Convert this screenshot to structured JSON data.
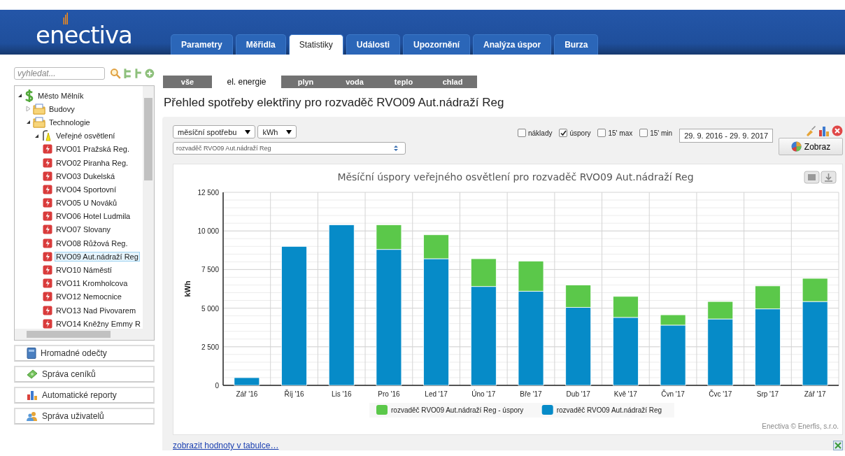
{
  "header": {
    "logo": "enectiva",
    "tabs": [
      {
        "label": "Parametry",
        "selected": false
      },
      {
        "label": "Měřidla",
        "selected": false
      },
      {
        "label": "Statistiky",
        "selected": true
      },
      {
        "label": "Události",
        "selected": false
      },
      {
        "label": "Upozornění",
        "selected": false
      },
      {
        "label": "Analýza úspor",
        "selected": false
      },
      {
        "label": "Burza",
        "selected": false
      }
    ]
  },
  "sidebar": {
    "search": {
      "placeholder": "vyhledat..."
    },
    "tree": [
      {
        "label": "Město Mělník",
        "kind": "root",
        "expanded": true,
        "selected": false,
        "children": [
          {
            "label": "Budovy",
            "kind": "folder",
            "expanded": false,
            "selected": false
          },
          {
            "label": "Technologie",
            "kind": "folder",
            "expanded": true,
            "selected": false,
            "children": [
              {
                "label": "Veřejné osvětlení",
                "kind": "lamp",
                "expanded": true,
                "selected": false,
                "children": [
                  {
                    "label": "RVO01 Pražská Reg.",
                    "kind": "meter",
                    "selected": false
                  },
                  {
                    "label": "RVO02 Piranha Reg.",
                    "kind": "meter",
                    "selected": false
                  },
                  {
                    "label": "RVO03 Dukelská",
                    "kind": "meter",
                    "selected": false
                  },
                  {
                    "label": "RVO04 Sportovní",
                    "kind": "meter",
                    "selected": false
                  },
                  {
                    "label": "RVO05 U Nováků",
                    "kind": "meter",
                    "selected": false
                  },
                  {
                    "label": "RVO06 Hotel Ludmila",
                    "kind": "meter",
                    "selected": false
                  },
                  {
                    "label": "RVO07 Slovany",
                    "kind": "meter",
                    "selected": false
                  },
                  {
                    "label": "RVO08 Růžová Reg.",
                    "kind": "meter",
                    "selected": false
                  },
                  {
                    "label": "RVO09 Aut.nádraží Reg",
                    "kind": "meter",
                    "selected": true
                  },
                  {
                    "label": "RVO10 Náměstí",
                    "kind": "meter",
                    "selected": false
                  },
                  {
                    "label": "RVO11 Kromholcova",
                    "kind": "meter",
                    "selected": false
                  },
                  {
                    "label": "RVO12 Nemocnice",
                    "kind": "meter",
                    "selected": false
                  },
                  {
                    "label": "RVO13 Nad Pivovarem",
                    "kind": "meter",
                    "selected": false
                  },
                  {
                    "label": "RVO14 Kněžny Emmy R",
                    "kind": "meter",
                    "selected": false
                  }
                ]
              }
            ]
          }
        ]
      }
    ],
    "buttons": [
      {
        "label": "Hromadné odečty",
        "kind": "book"
      },
      {
        "label": "Správa ceníků",
        "kind": "money"
      },
      {
        "label": "Automatické reporty",
        "kind": "bars"
      },
      {
        "label": "Správa uživatelů",
        "kind": "users"
      }
    ]
  },
  "energy_tabs": [
    {
      "label": "vše",
      "selected": false
    },
    {
      "label": "el. energie",
      "selected": true
    },
    {
      "label": "plyn",
      "selected": false
    },
    {
      "label": "voda",
      "selected": false
    },
    {
      "label": "teplo",
      "selected": false
    },
    {
      "label": "chlad",
      "selected": false
    }
  ],
  "heading": "Přehled spotřeby elektřiny pro rozvaděč RVO09 Aut.nádraží Reg",
  "controls": {
    "period": "měsíční spotřebu",
    "unit": "kWh",
    "meter": "rozvaděč RVO09 Aut.nádraží Reg",
    "options": [
      {
        "label": "náklady",
        "checked": false
      },
      {
        "label": "úspory",
        "checked": true
      },
      {
        "label": "15' max",
        "checked": false
      },
      {
        "label": "15' min",
        "checked": false
      }
    ],
    "date_range": "29. 9. 2016 - 29. 9. 2017",
    "show_button": "Zobraz"
  },
  "chart": {
    "credit": "Enectiva © Enerfis, s.r.o.",
    "chart_data": {
      "type": "bar",
      "title": "Měsíční úspory veřejného osvětlení pro rozvaděč RVO09 Aut.nádraží Reg",
      "ylabel": "kWh",
      "stacked": true,
      "categories": [
        "Zář '16",
        "Říj '16",
        "Lis '16",
        "Pro '16",
        "Led '17",
        "Úno '17",
        "Bře '17",
        "Dub '17",
        "Kvě '17",
        "Čvn '17",
        "Čvc '17",
        "Srp '17",
        "Zář '17"
      ],
      "series": [
        {
          "name": "rozvaděč RVO09 Aut.nádraží Reg - úspory",
          "color": "#5bc84a",
          "values": [
            0,
            0,
            0,
            1600,
            1550,
            1800,
            1950,
            1450,
            1360,
            670,
            1130,
            1490,
            1500
          ]
        },
        {
          "name": "rozvaděč RVO09 Aut.nádraží Reg",
          "color": "#068bc8",
          "values": [
            500,
            9000,
            10400,
            8800,
            8200,
            6400,
            6100,
            5050,
            4400,
            3900,
            4300,
            4950,
            5430
          ]
        }
      ],
      "ylim": [
        0,
        12500
      ],
      "grid": true,
      "legend": true,
      "yticks": [
        {
          "value": 0,
          "label": "0"
        },
        {
          "value": 2500,
          "label": "2 500"
        },
        {
          "value": 5000,
          "label": "5 000"
        },
        {
          "value": 7500,
          "label": "7 500"
        },
        {
          "value": 10000,
          "label": "10 000"
        },
        {
          "value": 12500,
          "label": "12 500"
        }
      ]
    }
  },
  "table_link": "zobrazit hodnoty v tabulce…"
}
